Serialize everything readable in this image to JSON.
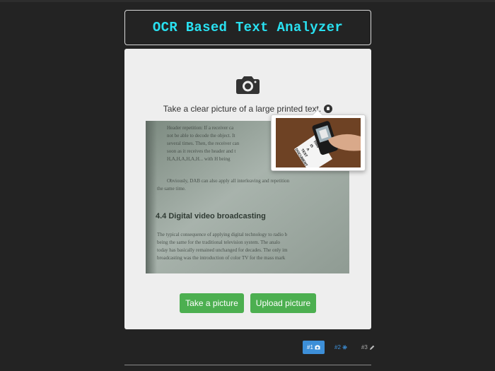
{
  "header": {
    "title": "OCR Based Text Analyzer"
  },
  "card": {
    "instruction": "Take a clear picture of a large printed text.",
    "buttons": {
      "take": "Take a picture",
      "upload": "Upload picture"
    }
  },
  "sample_photo": {
    "lines_top": [
      "Header repetition: If a receiver ca",
      "not be able to decode the object. It",
      "several times. Then, the receiver can",
      "soon as it receives the header and t",
      "H,A,H,A,H,A,H... with H being"
    ],
    "lines_mid": [
      "Obviously, DAB can also apply all interleaving and repetition",
      "the same time."
    ],
    "heading": "4.4 Digital video broadcasting",
    "lines_bottom": [
      "The typical consequence of applying digital technology to radio b",
      "being the same for the traditional television system. The analo",
      "today has basically remained unchanged for decades. The only im",
      "broadcasting was the introduction of color TV for the mass mark"
    ]
  },
  "popover_image": {
    "doc_text": [
      "THIS",
      "IS",
      "A",
      "TEST",
      "DOCUMENT"
    ]
  },
  "steps": [
    {
      "label": "#1",
      "icon": "camera-icon"
    },
    {
      "label": "#2",
      "icon": "gear-icon"
    },
    {
      "label": "#3",
      "icon": "pencil-icon"
    }
  ],
  "colors": {
    "accent": "#29e0f0",
    "button": "#4caf50",
    "active_step": "#3d8fd8"
  }
}
